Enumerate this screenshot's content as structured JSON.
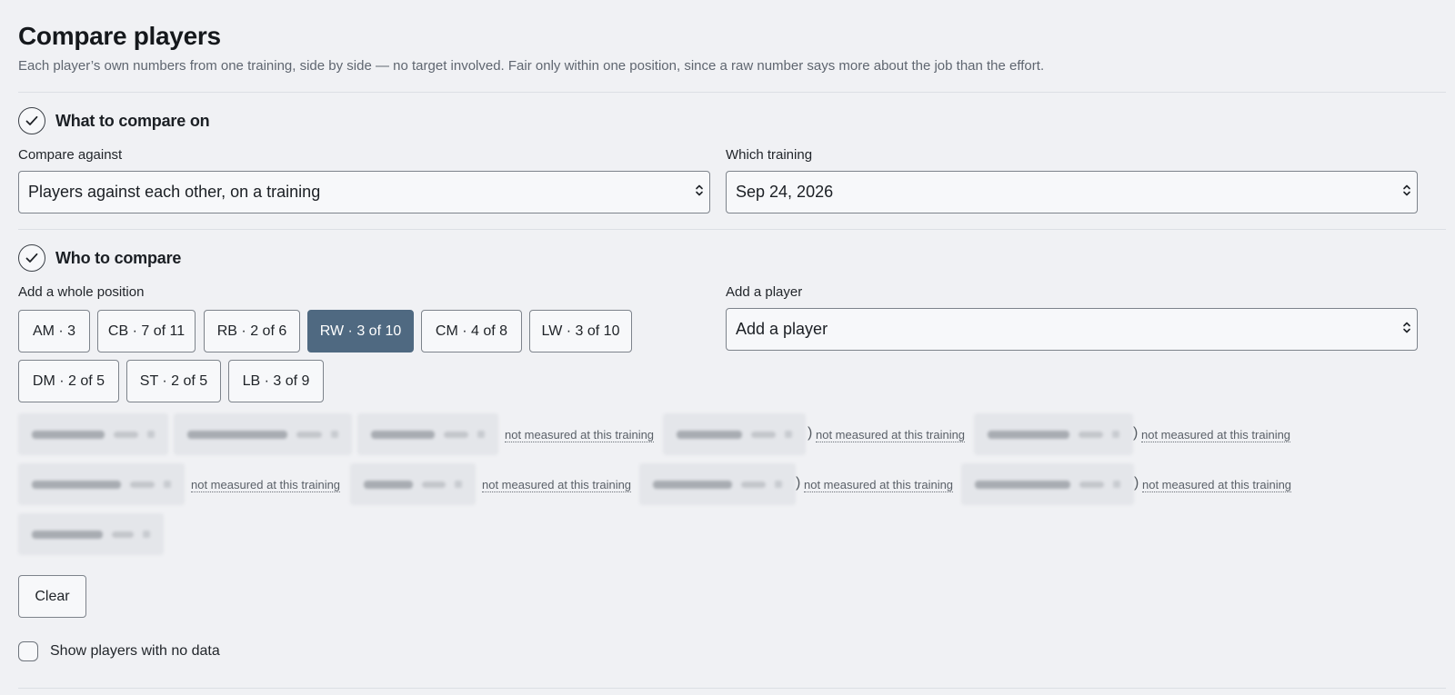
{
  "page": {
    "title": "Compare players",
    "subtitle": "Each player’s own numbers from one training, side by side — no target involved. Fair only within one position, since a raw number says more about the job than the effort."
  },
  "step_compare_on": {
    "title": "What to compare on",
    "icon": "check-icon",
    "compare_against_label": "Compare against",
    "compare_against_value": "Players against each other, on a training",
    "which_training_label": "Which training",
    "which_training_value": "Sep 24, 2026"
  },
  "step_who": {
    "title": "Who to compare",
    "icon": "check-icon",
    "whole_position_label": "Add a whole position",
    "add_player_label": "Add a player",
    "add_player_placeholder": "Add a player",
    "positions": [
      {
        "label": "AM · 3",
        "selected": false
      },
      {
        "label": "CB · 7 of 11",
        "selected": false
      },
      {
        "label": "RB · 2 of 6",
        "selected": false
      },
      {
        "label": "RW · 3 of 10",
        "selected": true
      },
      {
        "label": "CM · 4 of 8",
        "selected": false
      },
      {
        "label": "LW · 3 of 10",
        "selected": false
      },
      {
        "label": "DM · 2 of 5",
        "selected": false
      },
      {
        "label": "ST · 2 of 5",
        "selected": false
      },
      {
        "label": "LB · 3 of 9",
        "selected": false
      }
    ],
    "not_measured_note": "not measured at this training",
    "paren_close": ")",
    "clear_label": "Clear",
    "show_no_data_label": "Show players with no data",
    "show_no_data_checked": false
  },
  "colors": {
    "background": "#f0f1f4",
    "selected_position": "#4f6981",
    "border": "#7d838b"
  }
}
